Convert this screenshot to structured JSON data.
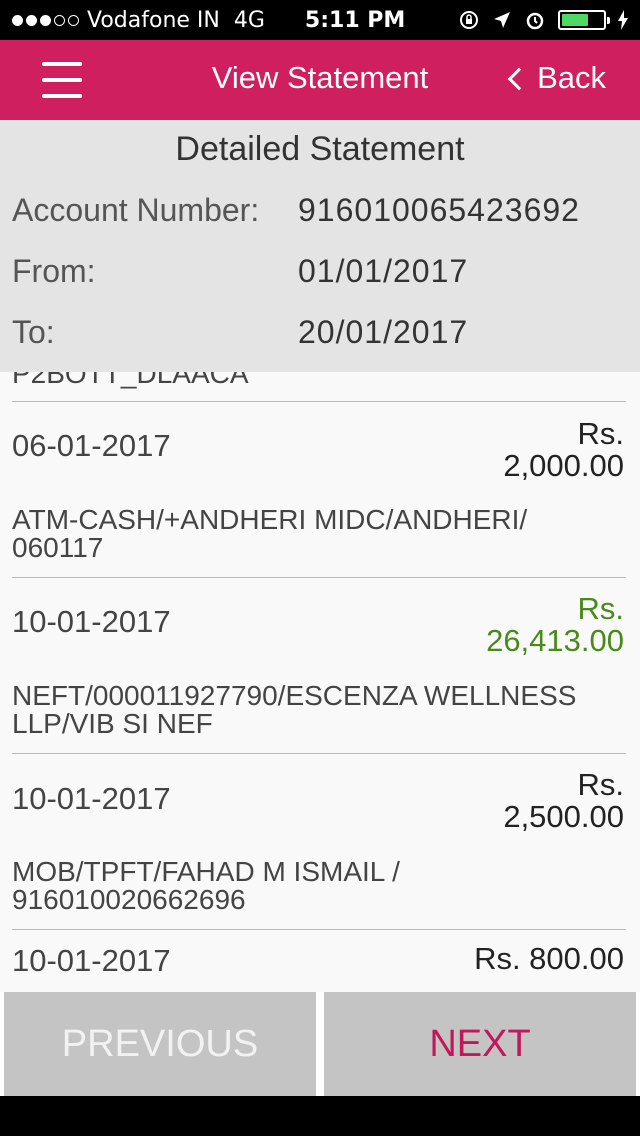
{
  "status_bar": {
    "carrier": "Vodafone IN",
    "network": "4G",
    "time": "5:11 PM"
  },
  "header": {
    "title": "View Statement",
    "back_label": "Back"
  },
  "statement": {
    "title": "Detailed Statement",
    "account_label": "Account Number:",
    "account_value": "916010065423692",
    "from_label": "From:",
    "from_value": "01/01/2017",
    "to_label": "To:",
    "to_value": "20/01/2017"
  },
  "transactions": [
    {
      "desc_partial": "P2BOTT_DLAACA"
    },
    {
      "date": "06-01-2017",
      "currency": "Rs.",
      "amount": "2,000.00",
      "type": "debit",
      "desc": "ATM-CASH/+ANDHERI MIDC/ANDHERI/ 060117"
    },
    {
      "date": "10-01-2017",
      "currency": "Rs.",
      "amount": "26,413.00",
      "type": "credit",
      "desc": "NEFT/000011927790/ESCENZA WELLNESS LLP/VIB  SI NEF"
    },
    {
      "date": "10-01-2017",
      "currency": "Rs.",
      "amount": "2,500.00",
      "type": "debit",
      "desc": "MOB/TPFT/FAHAD M ISMAIL / 916010020662696"
    },
    {
      "date": "10-01-2017",
      "amount_full": "Rs. 800.00",
      "type": "debit"
    }
  ],
  "footer": {
    "previous_label": "PREVIOUS",
    "next_label": "NEXT"
  },
  "colors": {
    "brand": "#d01f5f",
    "credit": "#4a8a1a",
    "next_text": "#c2185b"
  }
}
